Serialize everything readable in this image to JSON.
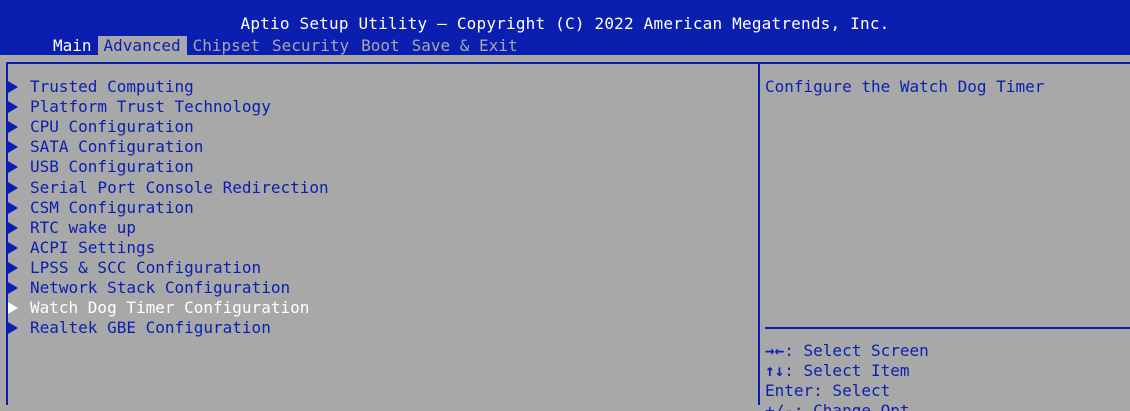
{
  "header": {
    "title": "Aptio Setup Utility – Copyright (C) 2022 American Megatrends, Inc.",
    "tabs": [
      "Main",
      "Advanced",
      "Chipset",
      "Security",
      "Boot",
      "Save & Exit"
    ]
  },
  "menu": {
    "items": [
      "Trusted Computing",
      "Platform Trust Technology",
      "CPU Configuration",
      "SATA Configuration",
      "USB Configuration",
      "Serial Port Console Redirection",
      "CSM Configuration",
      "RTC wake up",
      "ACPI Settings",
      "LPSS & SCC Configuration",
      "Network Stack Configuration",
      "Watch Dog Timer Configuration",
      "Realtek GBE Configuration"
    ],
    "selected_index": 11
  },
  "help": {
    "text": "Configure the Watch Dog Timer"
  },
  "keys": {
    "rows": [
      {
        "sym": "→←",
        "text": ": Select Screen"
      },
      {
        "sym": "↑↓",
        "text": ": Select Item"
      },
      {
        "sym": "",
        "text": "Enter: Select"
      },
      {
        "sym": "",
        "text": "+/-: Change Opt."
      }
    ]
  },
  "colors": {
    "bios_blue": "#0a1fb0",
    "bios_gray": "#a8a8a8",
    "highlight": "#ffffff"
  }
}
